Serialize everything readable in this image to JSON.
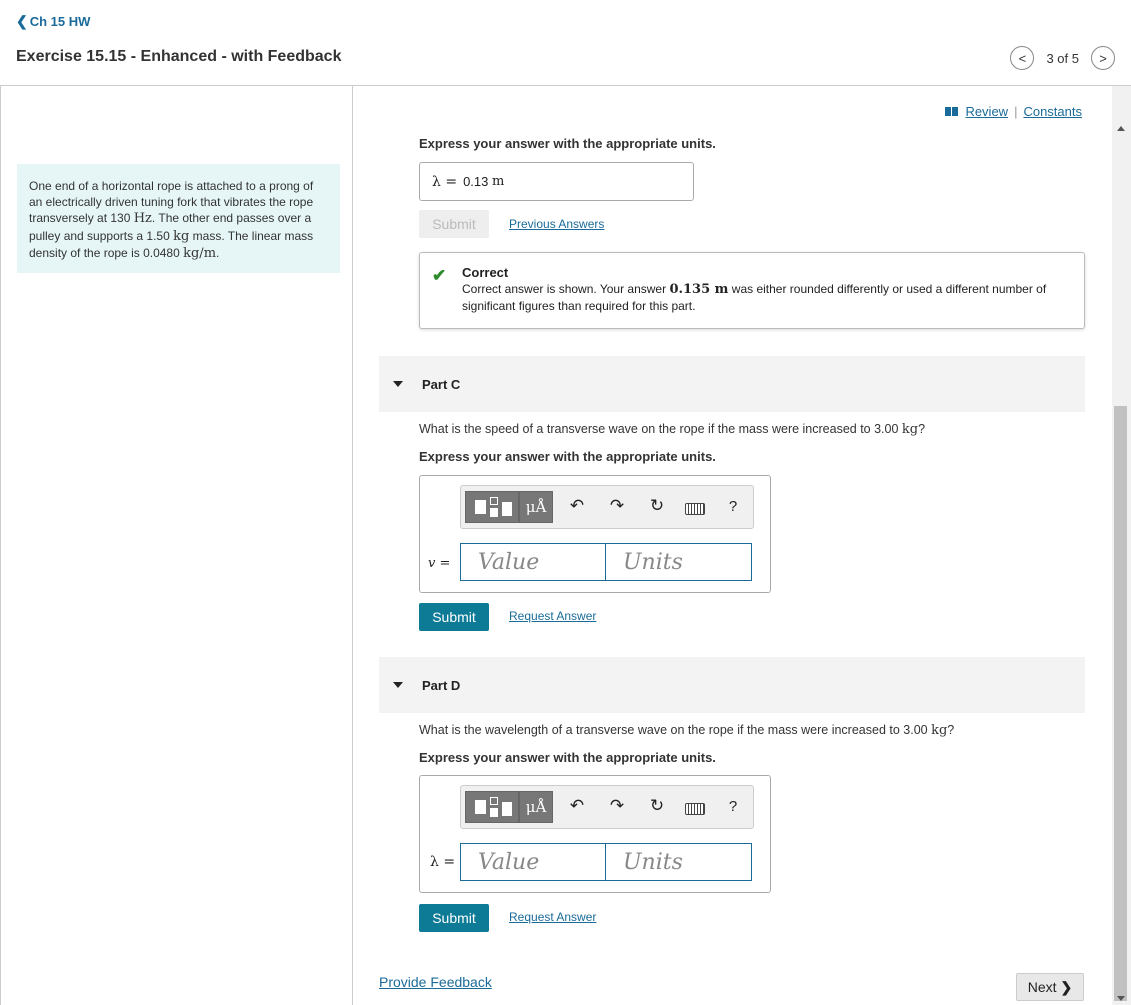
{
  "header": {
    "back_label": "Ch 15 HW",
    "title": "Exercise 15.15 - Enhanced - with Feedback",
    "pager_text": "3 of 5"
  },
  "problem": {
    "t1": "One end of a horizontal rope is attached to a prong of an electrically driven tuning fork that vibrates the rope transversely at 130 ",
    "u1": "Hz",
    "t2": ". The other end passes over a pulley and supports a 1.50 ",
    "u2": "kg",
    "t3": " mass. The linear mass density of the rope is 0.0480 ",
    "u3": "kg/m",
    "t4": "."
  },
  "review": {
    "review_label": "Review",
    "separator": "|",
    "constants_label": "Constants"
  },
  "part_b": {
    "instruction": "Express your answer with the appropriate units.",
    "symbol": "λ =",
    "answer_value": "0.13",
    "answer_unit": "m",
    "submit_label": "Submit",
    "previous_answers_label": "Previous Answers",
    "correct_title": "Correct",
    "correct_msg_1": "Correct answer is shown. Your answer ",
    "correct_msg_value": "0.135 m",
    "correct_msg_2": " was either rounded differently or used a different number of significant figures than required for this part."
  },
  "part_c": {
    "title": "Part C",
    "q1": "What is the speed of a transverse wave on the rope if the mass were increased to 3.00 ",
    "q_unit": "kg",
    "q2": "?",
    "instruction": "Express your answer with the appropriate units.",
    "symbol": "v =",
    "value_placeholder": "Value",
    "units_placeholder": "Units",
    "submit_label": "Submit",
    "request_label": "Request Answer"
  },
  "part_d": {
    "title": "Part D",
    "q1": "What is the wavelength of a transverse wave on the rope if the mass were increased to 3.00 ",
    "q_unit": "kg",
    "q2": "?",
    "instruction": "Express your answer with the appropriate units.",
    "symbol": "λ =",
    "value_placeholder": "Value",
    "units_placeholder": "Units",
    "submit_label": "Submit",
    "request_label": "Request Answer"
  },
  "toolbar": {
    "unit_symbol": "μÅ",
    "help_symbol": "?"
  },
  "footer": {
    "feedback_label": "Provide Feedback",
    "next_label": "Next"
  },
  "icons": {
    "back": "chevron-left-icon",
    "prev": "chevron-left-icon",
    "next": "chevron-right-icon",
    "book": "book-icon",
    "check": "checkmark-icon",
    "collapse": "triangle-down-icon",
    "undo": "undo-icon",
    "redo": "redo-icon",
    "reset": "reset-icon",
    "keyboard": "keyboard-icon"
  },
  "colors": {
    "accent": "#0d7a96",
    "link": "#1a6b9a",
    "correct": "#2e8b2e",
    "problem_bg": "#e6f6f7"
  }
}
